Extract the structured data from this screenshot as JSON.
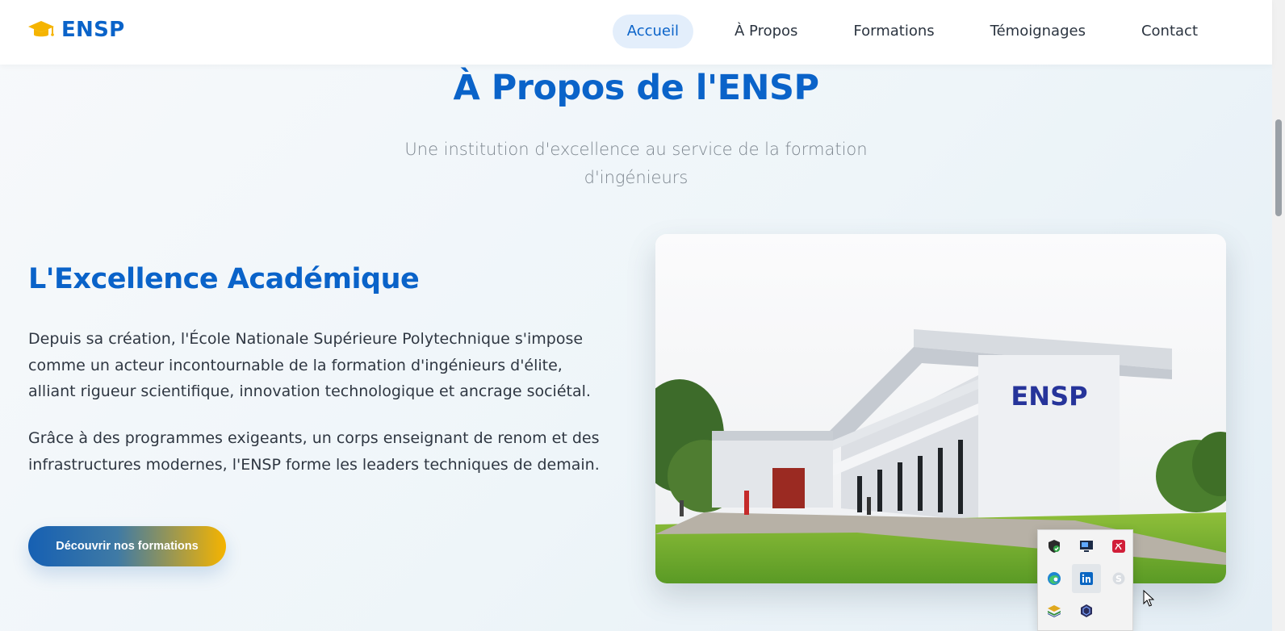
{
  "header": {
    "logo_text": "ENSP",
    "logo_icon": "graduation-cap-icon",
    "nav": [
      {
        "label": "Accueil",
        "active": true
      },
      {
        "label": "À Propos",
        "active": false
      },
      {
        "label": "Formations",
        "active": false
      },
      {
        "label": "Témoignages",
        "active": false
      },
      {
        "label": "Contact",
        "active": false
      }
    ]
  },
  "about": {
    "title": "À Propos de l'ENSP",
    "subtitle": "Une institution d'excellence au service de la formation d'ingénieurs",
    "heading": "L'Excellence Académique",
    "paragraph1": "Depuis sa création, l'École Nationale Supérieure Polytechnique s'impose comme un acteur incontournable de la formation d'ingénieurs d'élite, alliant rigueur scientifique, innovation technologique et ancrage sociétal.",
    "paragraph2": "Grâce à des programmes exigeants, un corps enseignant de renom et des infrastructures modernes, l'ENSP forme les leaders techniques de demain.",
    "cta_label": "Découvrir nos formations",
    "photo_sign": "ENSP"
  },
  "tray": {
    "icons": [
      "shield-check-icon",
      "remote-desktop-icon",
      "adobe-icon",
      "edge-icon",
      "linkedin-icon",
      "skype-icon",
      "stack-app-icon",
      "hexagon-app-icon"
    ]
  },
  "colors": {
    "brand_blue": "#0a63c9",
    "accent_gold": "#f5b400",
    "nav_active_bg": "#e3eefb"
  }
}
